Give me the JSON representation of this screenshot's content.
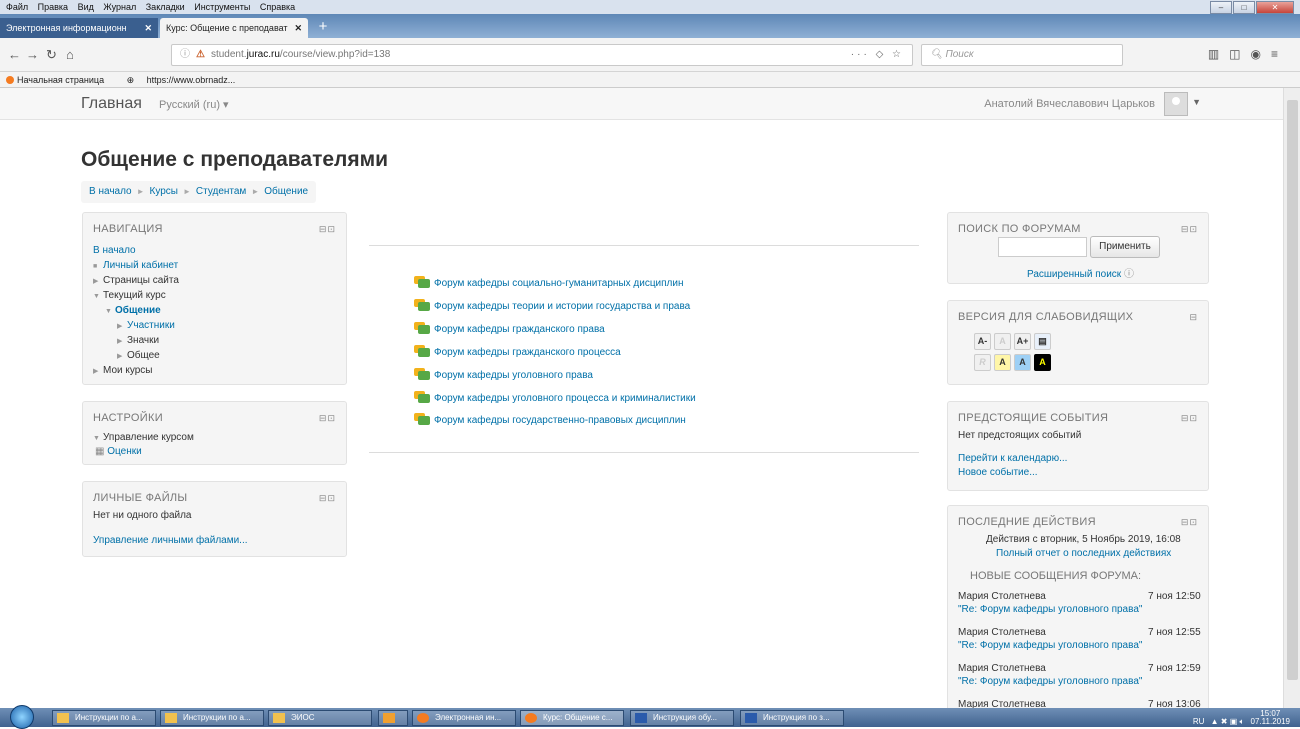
{
  "browser": {
    "menu": [
      "Файл",
      "Правка",
      "Вид",
      "Журнал",
      "Закладки",
      "Инструменты",
      "Справка"
    ],
    "tabs": [
      {
        "label": "Электронная информационн"
      },
      {
        "label": "Курс: Общение с преподават"
      }
    ],
    "url_prefix": "student.",
    "url_host": "jurac.ru",
    "url_path": "/course/view.php?id=138",
    "search_placeholder": "Поиск",
    "bookmarks": [
      "Начальная страница",
      "https://www.obrnadz..."
    ]
  },
  "header": {
    "brand": "Главная",
    "language": "Русский (ru) ▾",
    "user": "Анатолий Вячеславович Царьков"
  },
  "page_title": "Общение с преподавателями",
  "breadcrumb": [
    "В начало",
    "Курсы",
    "Студентам",
    "Общение"
  ],
  "navigation": {
    "title": "НАВИГАЦИЯ",
    "home": "В начало",
    "items": {
      "dashboard": "Личный кабинет",
      "site_pages": "Страницы сайта",
      "current_course": "Текущий курс",
      "course": "Общение",
      "participants": "Участники",
      "badges": "Значки",
      "general": "Общее",
      "my_courses": "Мои курсы"
    }
  },
  "settings": {
    "title": "НАСТРОЙКИ",
    "course_admin": "Управление курсом",
    "grades": "Оценки"
  },
  "private_files": {
    "title": "ЛИЧНЫЕ ФАЙЛЫ",
    "empty": "Нет ни одного файла",
    "manage": "Управление личными файлами..."
  },
  "forums": [
    "Форум кафедры социально-гуманитарных дисциплин",
    "Форум кафедры теории и истории государства и права",
    "Форум кафедры гражданского права",
    "Форум кафедры гражданского процесса",
    "Форум кафедры уголовного права",
    "Форум кафедры уголовного процесса и криминалистики",
    "Форум кафедры государственно-правовых дисциплин"
  ],
  "forum_search": {
    "title": "ПОИСК ПО ФОРУМАМ",
    "button": "Применить",
    "advanced": "Расширенный поиск"
  },
  "accessibility": {
    "title": "ВЕРСИЯ ДЛЯ СЛАБОВИДЯЩИХ",
    "buttons": [
      "A-",
      "A",
      "A+",
      "R",
      "A",
      "A",
      "A"
    ]
  },
  "upcoming": {
    "title": "ПРЕДСТОЯЩИЕ СОБЫТИЯ",
    "empty": "Нет предстоящих событий",
    "calendar": "Перейти к календарю...",
    "new_event": "Новое событие..."
  },
  "recent": {
    "title": "ПОСЛЕДНИЕ ДЕЙСТВИЯ",
    "since": "Действия с вторник, 5 Ноябрь 2019, 16:08",
    "full_report": "Полный отчет о последних действиях",
    "new_posts": "НОВЫЕ СООБЩЕНИЯ ФОРУМА:",
    "posts": [
      {
        "author": "Мария Столетнева",
        "time": "7 ноя 12:50",
        "subject": "\"Re: Форум кафедры уголовного права\""
      },
      {
        "author": "Мария Столетнева",
        "time": "7 ноя 12:55",
        "subject": "\"Re: Форум кафедры уголовного права\""
      },
      {
        "author": "Мария Столетнева",
        "time": "7 ноя 12:59",
        "subject": "\"Re: Форум кафедры уголовного права\""
      },
      {
        "author": "Мария Столетнева",
        "time": "7 ноя 13:06",
        "subject": ""
      }
    ]
  },
  "taskbar": {
    "items": [
      "Инструкции по а...",
      "Инструкции по а...",
      "ЭИОС",
      "Электронная ин...",
      "Курс: Общение с...",
      "Инструкция обу...",
      "Инструкция по з..."
    ],
    "lang": "RU",
    "clock": "15:07",
    "date": "07.11.2019"
  }
}
